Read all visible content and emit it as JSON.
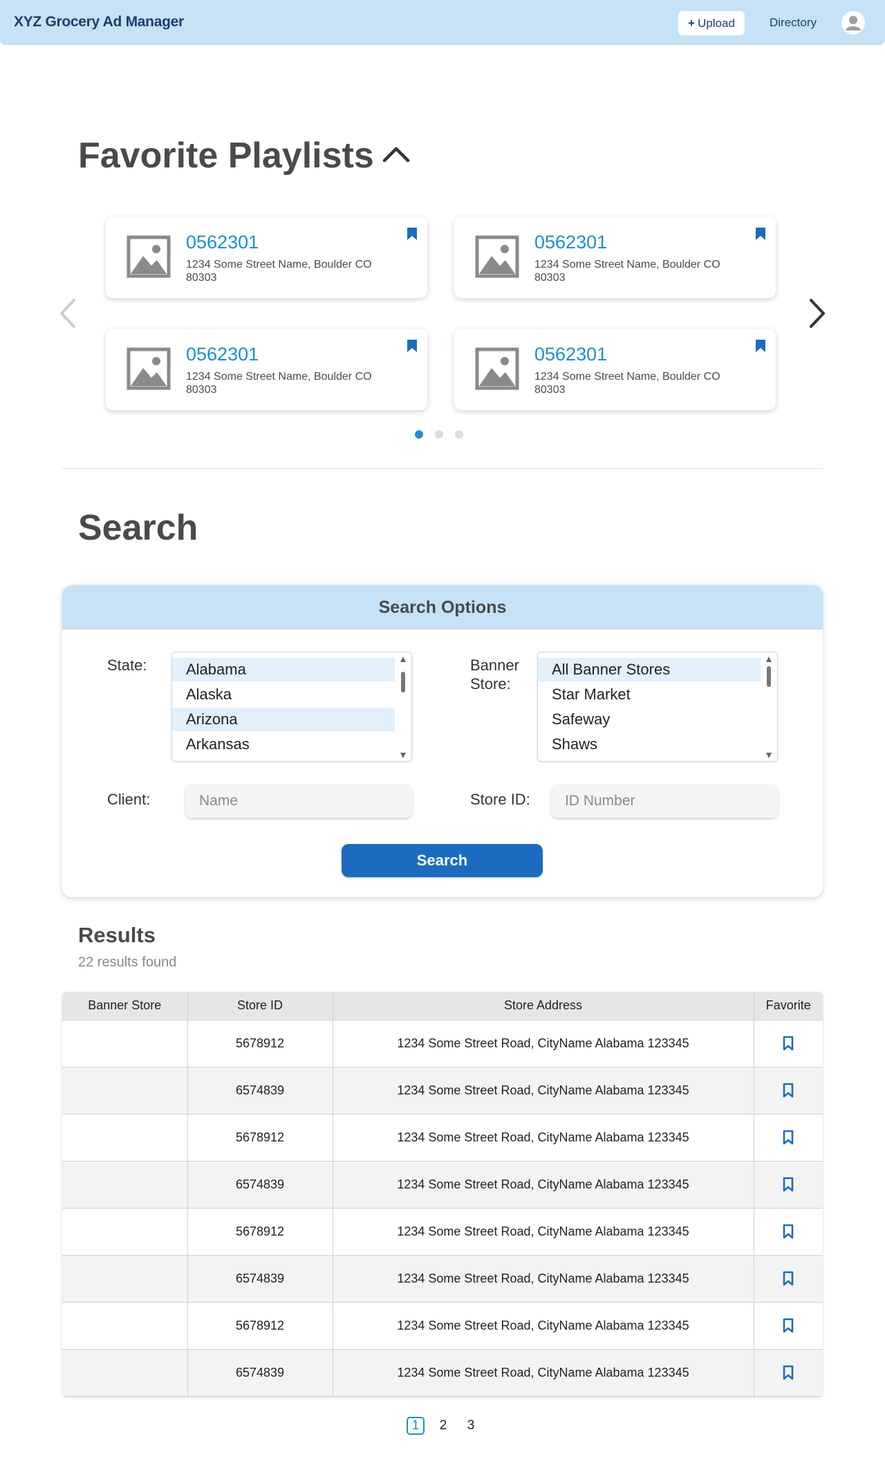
{
  "header": {
    "brand": "XYZ Grocery Ad Manager",
    "upload_label": "Upload",
    "directory_label": "Directory",
    "avatar_icon": "user-avatar-icon"
  },
  "favorites": {
    "title": "Favorite Playlists",
    "cards": [
      {
        "store_id": "0562301",
        "address": "1234 Some Street Name, Boulder CO 80303"
      },
      {
        "store_id": "0562301",
        "address": "1234 Some Street Name, Boulder CO 80303"
      },
      {
        "store_id": "0562301",
        "address": "1234 Some Street Name, Boulder CO 80303"
      },
      {
        "store_id": "0562301",
        "address": "1234 Some Street Name, Boulder CO 80303"
      }
    ],
    "current_page": 1,
    "page_count": 3
  },
  "search": {
    "title": "Search",
    "panel_title": "Search Options",
    "state_label": "State:",
    "state_options": [
      "Alabama",
      "Alaska",
      "Arizona",
      "Arkansas"
    ],
    "banner_label": "Banner\nStore:",
    "banner_options": [
      "All Banner Stores",
      "Star Market",
      "Safeway",
      "Shaws"
    ],
    "client_label": "Client:",
    "client_placeholder": "Name",
    "store_id_label": "Store ID:",
    "store_id_placeholder": "ID Number",
    "button_label": "Search"
  },
  "results": {
    "title": "Results",
    "count_text": "22 results found",
    "columns": [
      "Banner Store",
      "Store ID",
      "Store Address",
      "Favorite"
    ],
    "rows": [
      {
        "banner": "",
        "store_id": "5678912",
        "address": "1234 Some Street Road, CityName Alabama 123345"
      },
      {
        "banner": "",
        "store_id": "6574839",
        "address": "1234 Some Street Road, CityName Alabama 123345"
      },
      {
        "banner": "",
        "store_id": "5678912",
        "address": "1234 Some Street Road, CityName Alabama 123345"
      },
      {
        "banner": "",
        "store_id": "6574839",
        "address": "1234 Some Street Road, CityName Alabama 123345"
      },
      {
        "banner": "",
        "store_id": "5678912",
        "address": "1234 Some Street Road, CityName Alabama 123345"
      },
      {
        "banner": "",
        "store_id": "6574839",
        "address": "1234 Some Street Road, CityName Alabama 123345"
      },
      {
        "banner": "",
        "store_id": "5678912",
        "address": "1234 Some Street Road, CityName Alabama 123345"
      },
      {
        "banner": "",
        "store_id": "6574839",
        "address": "1234 Some Street Road, CityName Alabama 123345"
      }
    ],
    "pages": [
      "1",
      "2",
      "3"
    ],
    "current_page": "1"
  },
  "colors": {
    "header_bg": "#c5e2f6",
    "brand_text": "#1f3d6b",
    "link_blue": "#1a8fd0",
    "primary_button": "#1b6cc0"
  }
}
